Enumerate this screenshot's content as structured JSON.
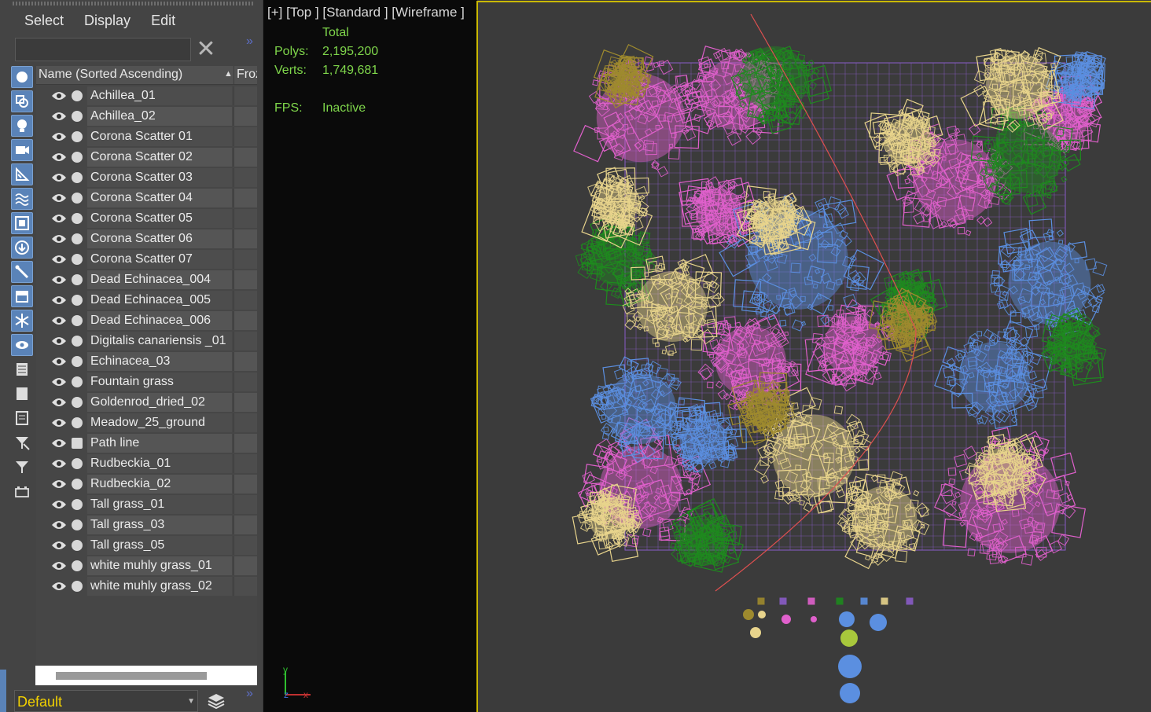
{
  "menu": {
    "select": "Select",
    "display": "Display",
    "edit": "Edit"
  },
  "search": {
    "value": "",
    "clear_icon": "close-icon"
  },
  "columns": {
    "name": "Name (Sorted Ascending)",
    "frozen": "Froz"
  },
  "rows": [
    {
      "name": "Achillea_01",
      "type": "object"
    },
    {
      "name": "Achillea_02",
      "type": "object"
    },
    {
      "name": "Corona Scatter 01",
      "type": "object"
    },
    {
      "name": "Corona Scatter 02",
      "type": "object"
    },
    {
      "name": "Corona Scatter 03",
      "type": "object"
    },
    {
      "name": "Corona Scatter 04",
      "type": "object"
    },
    {
      "name": "Corona Scatter 05",
      "type": "object"
    },
    {
      "name": "Corona Scatter 06",
      "type": "object"
    },
    {
      "name": "Corona Scatter 07",
      "type": "object"
    },
    {
      "name": "Dead Echinacea_004",
      "type": "object"
    },
    {
      "name": "Dead Echinacea_005",
      "type": "object"
    },
    {
      "name": "Dead Echinacea_006",
      "type": "object"
    },
    {
      "name": "Digitalis canariensis _01",
      "type": "object"
    },
    {
      "name": "Echinacea_03",
      "type": "object"
    },
    {
      "name": "Fountain grass",
      "type": "object"
    },
    {
      "name": "Goldenrod_dried_02",
      "type": "object"
    },
    {
      "name": "Meadow_25_ground",
      "type": "object"
    },
    {
      "name": "Path line",
      "type": "shape"
    },
    {
      "name": "Rudbeckia_01",
      "type": "object"
    },
    {
      "name": "Rudbeckia_02",
      "type": "object"
    },
    {
      "name": "Tall grass_01",
      "type": "object"
    },
    {
      "name": "Tall grass_03",
      "type": "object"
    },
    {
      "name": "Tall grass_05",
      "type": "object"
    },
    {
      "name": "white muhly grass_01",
      "type": "object"
    },
    {
      "name": "white muhly grass_02",
      "type": "object"
    }
  ],
  "layer": {
    "current": "Default"
  },
  "viewport": {
    "label": "[+] [Top ] [Standard ] [Wireframe ]",
    "stats": {
      "header": "Total",
      "polys_label": "Polys:",
      "polys": "2,195,200",
      "verts_label": "Verts:",
      "verts": "1,749,681",
      "fps_label": "FPS:",
      "fps": "Inactive"
    },
    "axis": {
      "y": "y",
      "z": "z",
      "x": "x"
    }
  },
  "colors": {
    "pink": "#e060cc",
    "blue": "#5b8fe0",
    "green": "#1e8a1e",
    "cream": "#e8d48c",
    "olive": "#9e8a2e",
    "purple": "#8a5cc8",
    "stat_green": "#7fd64b",
    "frame_yellow": "#c9b800",
    "layer_yellow": "#f2d100"
  },
  "toolbar_icons": [
    "geometry-icon",
    "shapes-icon",
    "lights-icon",
    "cameras-icon",
    "helpers-icon",
    "spacewarps-icon",
    "groups-icon",
    "xrefs-icon",
    "bones-icon",
    "containers-icon",
    "frozen-icon",
    "hidden-icon",
    "select-all-icon",
    "select-none-icon",
    "invert-icon",
    "filter-clear-icon",
    "filter-icon",
    "layers-toggle-icon"
  ]
}
